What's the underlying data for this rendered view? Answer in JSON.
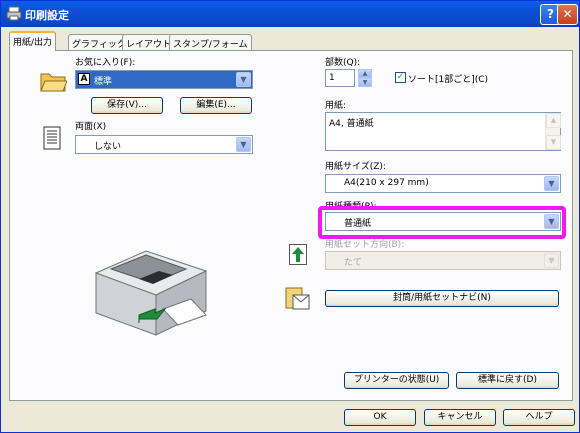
{
  "window": {
    "title": "印刷設定",
    "help_button": "?",
    "close_button": "✕"
  },
  "tabs": [
    {
      "label": "用紙/出力",
      "active": true
    },
    {
      "label": "グラフィックス",
      "active": false
    },
    {
      "label": "レイアウト",
      "active": false
    },
    {
      "label": "スタンプ/フォーム",
      "active": false
    }
  ],
  "favorites": {
    "label": "お気に入り(F):",
    "value": "標準",
    "save_button": "保存(V)...",
    "edit_button": "編集(E)..."
  },
  "duplex": {
    "label": "両面(X)",
    "value": "しない"
  },
  "copies": {
    "label": "部数(Q):",
    "value": "1",
    "collate_label": "ソート[1部ごと](C)",
    "collate_checked": true
  },
  "paper": {
    "label": "用紙:",
    "summary": "A4, 普通紙"
  },
  "paper_size": {
    "label": "用紙サイズ(Z):",
    "value": "A4(210 x 297 mm)"
  },
  "paper_type": {
    "label": "用紙種類(P):",
    "value": "普通紙"
  },
  "paper_orientation": {
    "label": "用紙セット方向(B):",
    "value": "たて",
    "enabled": false
  },
  "envelope_button": "封筒/用紙セットナビ(N)",
  "printer_status_button": "プリンターの状態(U)",
  "restore_defaults_button": "標準に戻す(D)",
  "dialog_buttons": {
    "ok": "OK",
    "cancel": "キャンセル",
    "help": "ヘルプ"
  },
  "colors": {
    "highlight": "#f417f4",
    "title_bar": "#0b4fd5",
    "face": "#ece9d8"
  }
}
